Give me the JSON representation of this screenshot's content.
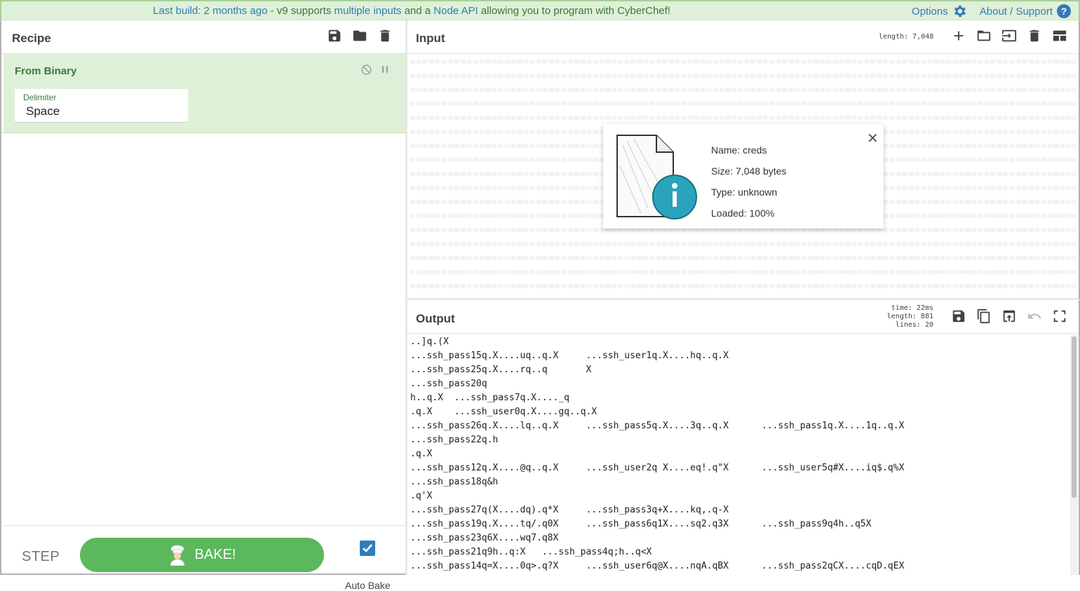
{
  "banner": {
    "prefix": "Last build: 2 months ago",
    "middle1": " - v9 supports ",
    "link1": "multiple inputs",
    "middle2": " and a ",
    "link2": "Node API",
    "suffix": " allowing you to program with CyberChef!",
    "options_label": "Options",
    "about_label": "About / Support"
  },
  "recipe": {
    "title": "Recipe",
    "operation": {
      "name": "From Binary",
      "arg_label": "Delimiter",
      "arg_value": "Space"
    },
    "step_label": "STEP",
    "bake_label": "BAKE!",
    "autobake_label": "Auto Bake",
    "autobake_checked": true
  },
  "input": {
    "title": "Input",
    "length": "length: 7,048"
  },
  "file": {
    "name": "Name: creds",
    "size": "Size: 7,048 bytes",
    "type": "Type: unknown",
    "loaded": "Loaded: 100%"
  },
  "output": {
    "title": "Output",
    "time": "time: 22ms",
    "length": "length:  881",
    "lines": "lines:   20",
    "text": "..]q.(X\n...ssh_pass15q.X....uq..q.X     ...ssh_user1q.X....hq..q.X\n...ssh_pass25q.X....rq..q       X\n...ssh_pass20q\nh..q.X  ...ssh_pass7q.X...._q\n.q.X    ...ssh_user0q.X....gq..q.X\n...ssh_pass26q.X....lq..q.X     ...ssh_pass5q.X....3q..q.X      ...ssh_pass1q.X....1q..q.X\n...ssh_pass22q.h\n.q.X\n...ssh_pass12q.X....@q..q.X     ...ssh_user2q X....eq!.q\"X      ...ssh_user5q#X....iq$.q%X\n...ssh_pass18q&h\n.q'X\n...ssh_pass27q(X....dq).q*X     ...ssh_pass3q+X....kq,.q-X\n...ssh_pass19q.X....tq/.q0X     ...ssh_pass6q1X....sq2.q3X      ...ssh_pass9q4h..q5X\n...ssh_pass23q6X....wq7.q8X\n...ssh_pass21q9h..q:X   ...ssh_pass4q;h..q<X\n...ssh_pass14q=X....0q>.q?X     ...ssh_user6q@X....nqA.qBX      ...ssh_pass2qCX....cqD.qEX"
  },
  "colors": {
    "banner_bg": "#dff0d8",
    "operation_bg": "#dff0d8",
    "bake_green": "#5cb85c",
    "link_blue": "#337ab7"
  },
  "icons": {
    "recipe": [
      "save-icon",
      "folder-icon",
      "trash-icon"
    ],
    "operation": [
      "disable-icon",
      "breakpoint-icon"
    ],
    "input": [
      "add-tab-icon",
      "open-folder-icon",
      "open-file-icon",
      "trash-icon",
      "layout-icon"
    ],
    "output": [
      "save-icon",
      "copy-icon",
      "move-to-input-icon",
      "undo-icon",
      "maximise-icon"
    ]
  }
}
